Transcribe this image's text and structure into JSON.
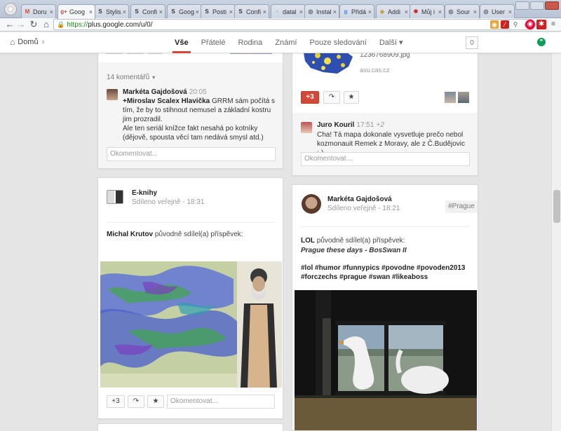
{
  "browser": {
    "tabs": [
      {
        "title": "Doru",
        "icon": "gmail-icon",
        "fav": "M",
        "color": "#d34836"
      },
      {
        "title": "Goog",
        "icon": "google-plus-icon",
        "fav": "g+",
        "color": "#d34836"
      },
      {
        "title": "Stylis",
        "icon": "stylish-icon",
        "fav": "S",
        "color": "#333333"
      },
      {
        "title": "Confi",
        "icon": "stylish-icon",
        "fav": "S",
        "color": "#333333"
      },
      {
        "title": "Goog",
        "icon": "stylish-icon",
        "fav": "S",
        "color": "#333333"
      },
      {
        "title": "Posti",
        "icon": "stylish-icon",
        "fav": "S",
        "color": "#333333"
      },
      {
        "title": "Confi",
        "icon": "stylish-icon",
        "fav": "S",
        "color": "#333333"
      },
      {
        "title": "datal",
        "icon": "page-icon",
        "fav": "▫",
        "color": "#888888"
      },
      {
        "title": "Instal",
        "icon": "github-icon",
        "fav": "◎",
        "color": "#555555"
      },
      {
        "title": "Přidá",
        "icon": "google-icon",
        "fav": "g",
        "color": "#4285f4"
      },
      {
        "title": "Addi",
        "icon": "addon-icon",
        "fav": "◆",
        "color": "#c8a040"
      },
      {
        "title": "Můj i",
        "icon": "star-icon",
        "fav": "✱",
        "color": "#cc2222"
      },
      {
        "title": "Sour",
        "icon": "github-icon",
        "fav": "◎",
        "color": "#555555"
      },
      {
        "title": "User",
        "icon": "github-icon",
        "fav": "◎",
        "color": "#555555"
      }
    ],
    "url_https": "https://",
    "url_rest": "plus.google.com/u/0/"
  },
  "nav": {
    "home": "Domů",
    "streams": [
      "Vše",
      "Přátelé",
      "Rodina",
      "Známí",
      "Pouze sledování",
      "Další"
    ],
    "notif_count": "0"
  },
  "card_top_left": {
    "comments_toggle": "14 komentářů",
    "comment_author": "Markéta Gajdošová",
    "comment_time": "20:05",
    "mention": "+Miroslav Scalex Hlavička",
    "comment_text": "GRRM sám počítá s tím, že by to stihnout nemusel a základní kostru jim prozradil.",
    "comment_text2": "Ale ten seriál knížce fakt nesahá po kotníky (dějově, spousta věcí tam nedává smysl atd.)",
    "input_placeholder": "Okomentovat..."
  },
  "card_top_right": {
    "link_title": "1236768909.jpg",
    "link_domain": "asu.cas.cz",
    "plus_count": "+3",
    "comment_author": "Juro Kouril",
    "comment_time": "17:51",
    "comment_plus": "+2",
    "comment_text": "Cha! Tá mapa dokonale vysvetluje prečo nebol kozmonauit Remek z Moravy, ale z Č.Budějovic ;-)",
    "input_placeholder": "Okomentovat..."
  },
  "card_ekniha": {
    "author": "E-knihy",
    "shared": "Sdíleno veřejně",
    "time": "18:31",
    "reshare_author": "Michal Krutov",
    "reshare_text": "původně sdílel(a) příspěvek:",
    "plus_count": "+3",
    "input_placeholder": "Okomentovat..."
  },
  "card_marketa": {
    "author": "Markéta Gajdošová",
    "shared": "Sdíleno veřejně",
    "time": "18:21",
    "hashtag": "#Prague",
    "reshare_author": "LOL",
    "reshare_text": "původně sdílel(a) příspěvek:",
    "subtitle": "Prague these days - BosSwan II",
    "tags_line1": "#lol #humor #funnypics #povodne #povoden2013",
    "tags_line2": "#forczechs #prague #swan #likeaboss"
  }
}
